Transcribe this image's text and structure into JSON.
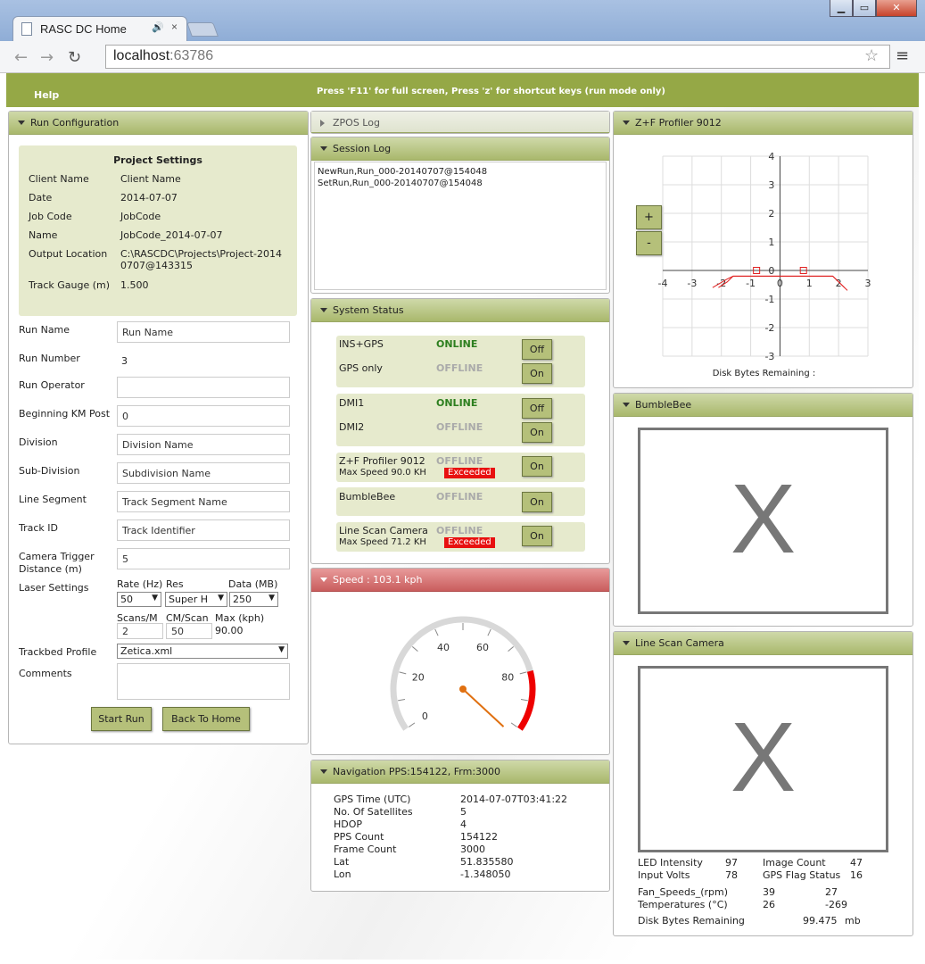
{
  "browser": {
    "tab_title": "RASC DC Home",
    "audio_icon": "🔊",
    "close_glyph": "×",
    "url_host": "localhost",
    "url_port": ":63786"
  },
  "header": {
    "help": "Help",
    "hint": "Press 'F11' for full screen, Press 'z' for shortcut keys (run mode only)"
  },
  "run_config": {
    "title": "Run Configuration",
    "project": {
      "title": "Project Settings",
      "rows": [
        {
          "label": "Client Name",
          "value": "Client Name"
        },
        {
          "label": "Date",
          "value": "2014-07-07"
        },
        {
          "label": "Job Code",
          "value": "JobCode"
        },
        {
          "label": "Name",
          "value": "JobCode_2014-07-07"
        },
        {
          "label": "Output Location",
          "value": "C:\\RASCDC\\Projects\\Project-20140707@143315"
        },
        {
          "label": "Track Gauge (m)",
          "value": "1.500"
        }
      ]
    },
    "fields": {
      "run_name_label": "Run Name",
      "run_name_value": "Run Name",
      "run_number_label": "Run Number",
      "run_number_value": "3",
      "run_operator_label": "Run Operator",
      "run_operator_value": "",
      "km_post_label": "Beginning KM Post",
      "km_post_value": "0",
      "division_label": "Division",
      "division_value": "Division Name",
      "subdivision_label": "Sub-Division",
      "subdivision_value": "Subdivision Name",
      "line_segment_label": "Line Segment",
      "line_segment_value": "Track Segment Name",
      "track_id_label": "Track ID",
      "track_id_value": "Track Identifier",
      "camera_trigger_label": "Camera Trigger Distance (m)",
      "camera_trigger_value": "5",
      "laser_label": "Laser Settings",
      "rate_label": "Rate (Hz)",
      "res_label": "Res",
      "data_label": "Data (MB)",
      "rate_value": "50",
      "res_value": "Super H",
      "data_value": "250",
      "scans_label": "Scans/M",
      "cmscan_label": "CM/Scan",
      "maxkph_label": "Max (kph)",
      "scans_value": "2",
      "cmscan_value": "50",
      "maxkph_value": "90.00",
      "trackbed_label": "Trackbed Profile",
      "trackbed_value": "Zetica.xml",
      "comments_label": "Comments",
      "comments_value": ""
    },
    "start_button": "Start Run",
    "back_button": "Back To Home"
  },
  "zpos_log": {
    "title": "ZPOS Log"
  },
  "session_log": {
    "title": "Session Log",
    "lines": [
      "NewRun,Run_000-20140707@154048",
      "SetRun,Run_000-20140707@154048"
    ]
  },
  "system_status": {
    "title": "System Status",
    "devices": [
      {
        "name": "INS+GPS",
        "status": "ONLINE",
        "button": "Off"
      },
      {
        "name": "GPS only",
        "status": "OFFLINE",
        "button": "On"
      },
      {
        "name": "DMI1",
        "status": "ONLINE",
        "button": "Off"
      },
      {
        "name": "DMI2",
        "status": "OFFLINE",
        "button": "On"
      },
      {
        "name": "Z+F Profiler 9012",
        "status": "OFFLINE",
        "button": "On",
        "sub": "Max Speed 90.0 KH",
        "badge": "Exceeded"
      },
      {
        "name": "BumbleBee",
        "status": "OFFLINE",
        "button": "On"
      },
      {
        "name": "Line Scan Camera",
        "status": "OFFLINE",
        "button": "On",
        "sub": "Max Speed 71.2 KH",
        "badge": "Exceeded"
      }
    ],
    "colors": {
      "online": "#2d7f1f",
      "offline": "#aaaaaa",
      "exceeded": "#e81010"
    }
  },
  "speed": {
    "title": "Speed   : 103.1 kph",
    "gauge_labels": [
      "0",
      "20",
      "40",
      "60",
      "80"
    ],
    "gauge_max": 100,
    "needle_value": 103.1,
    "redline_from": 80
  },
  "navigation": {
    "title": "Navigation PPS:154122, Frm:3000",
    "rows": [
      {
        "label": "GPS Time (UTC)",
        "value": "2014-07-07T03:41:22"
      },
      {
        "label": "No. Of Satellites",
        "value": "5"
      },
      {
        "label": "HDOP",
        "value": "4"
      },
      {
        "label": "PPS Count",
        "value": "154122"
      },
      {
        "label": "Frame Count",
        "value": "3000"
      },
      {
        "label": "Lat",
        "value": "51.835580"
      },
      {
        "label": "Lon",
        "value": "-1.348050"
      }
    ]
  },
  "profiler": {
    "title": "Z+F Profiler 9012",
    "zoom_in": "+",
    "zoom_out": "-",
    "disk_label": "Disk Bytes Remaining :",
    "chart_data": {
      "type": "line",
      "xlim": [
        -4,
        3
      ],
      "ylim": [
        -3,
        4
      ],
      "x_ticks": [
        "-4",
        "-3",
        "-2",
        "-1",
        "0",
        "1",
        "2",
        "3"
      ],
      "y_ticks": [
        "4",
        "3",
        "2",
        "1",
        "0",
        "-1",
        "-2",
        "-3"
      ],
      "grid": true,
      "series": [
        {
          "x": [
            -2.1,
            -1.8,
            -1.6,
            -1.1,
            -0.5,
            0.8,
            1.8,
            2.2
          ],
          "y": [
            -0.6,
            -0.4,
            -0.2,
            -0.2,
            -0.2,
            -0.2,
            -0.2,
            -0.6
          ],
          "color": "#e02020"
        },
        {
          "x": [
            -2.3,
            -1.8,
            -1.6,
            -1.1,
            -0.5,
            0.8,
            1.8,
            2.3
          ],
          "y": [
            -0.6,
            -0.3,
            -0.2,
            -0.2,
            -0.2,
            -0.2,
            -0.2,
            -0.7
          ],
          "color": "#e02020"
        }
      ],
      "markers": {
        "x": [
          -0.8,
          0.8
        ],
        "y": [
          0,
          0
        ],
        "color": "#e02020"
      }
    }
  },
  "bumblebee": {
    "title": "BumbleBee",
    "placeholder": "X"
  },
  "linescan": {
    "title": "Line Scan Camera",
    "placeholder": "X",
    "stats": {
      "led_label": "LED Intensity",
      "led_value": "97",
      "img_label": "Image Count",
      "img_value": "47",
      "volts_label": "Input Volts",
      "volts_value": "78",
      "gps_label": "GPS Flag Status",
      "gps_value": "16",
      "fan_label": "Fan_Speeds_(rpm)",
      "fan_a": "39",
      "fan_b": "27",
      "temp_label": "Temperatures (°C)",
      "temp_a": "26",
      "temp_b": "-269",
      "disk_label": "Disk Bytes Remaining",
      "disk_value": "99.475",
      "disk_unit": "mb"
    }
  }
}
